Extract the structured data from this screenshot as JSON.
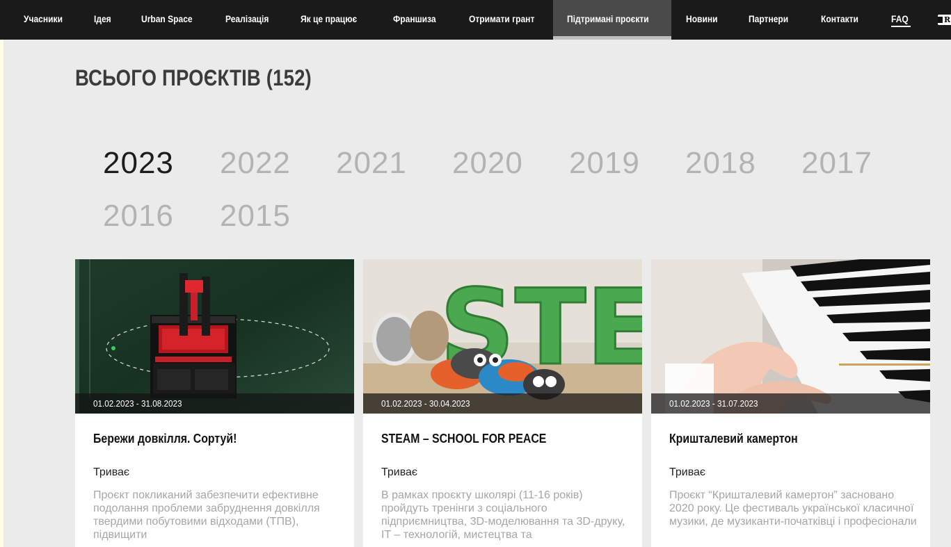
{
  "nav": {
    "items": [
      {
        "label": "Учасники"
      },
      {
        "label": "Ідея"
      },
      {
        "label": "Urban Space"
      },
      {
        "label": "Реалізація"
      },
      {
        "label": "Як це працює"
      },
      {
        "label": "Франшиза"
      },
      {
        "label": "Отримати грант"
      },
      {
        "label": "Підтримані проєкти",
        "active": true
      },
      {
        "label": "Новини"
      },
      {
        "label": "Партнери"
      },
      {
        "label": "Контакти"
      },
      {
        "label": "FAQ"
      }
    ],
    "lang_letter": "R"
  },
  "page": {
    "title": "ВСЬОГО ПРОЄКТІВ (152)"
  },
  "years": [
    "2023",
    "2022",
    "2021",
    "2020",
    "2019",
    "2018",
    "2017",
    "2016",
    "2015"
  ],
  "active_year": "2023",
  "cards": [
    {
      "date": "01.02.2023 - 31.08.2023",
      "title": "Бережи довкілля. Сортуй!",
      "status": "Триває",
      "description": "Проєкт покликаний забезпечити ефективне подолання проблеми забруднення довкілля твердими побутовими відходами (ТПВ), підвищити"
    },
    {
      "date": "01.02.2023 - 30.04.2023",
      "title": "STEAM – SCHOOL FOR PEACE",
      "status": "Триває",
      "description": "В рамках проєкту школярі (11-16 років) пройдуть тренінги з соціального підприємництва, 3D-моделювання та 3D-друку, IT – технологій, мистецтва та"
    },
    {
      "date": "01.02.2023 - 31.07.2023",
      "title": "Кришталевий камертон",
      "status": "Триває",
      "description": "Проєкт “Кришталевий камертон” засновано 2020 року. Це фестиваль української класичної музики, де музиканти-початківці і професіонали"
    }
  ],
  "images": {
    "card1": "sorting-bin-photo",
    "card2": "steam-letters-owl-pillows-photo",
    "card3": "child-hands-piano-photo"
  },
  "image_text": {
    "steam_letters": "STE"
  },
  "colors": {
    "nav_bg": "#1a1a1a",
    "nav_active": "#4a4a4a",
    "page_bg": "#ebebeb",
    "year_active": "#1d1d1d",
    "year_inactive": "#b3b3b3",
    "desc_text": "#a6a6a6"
  }
}
